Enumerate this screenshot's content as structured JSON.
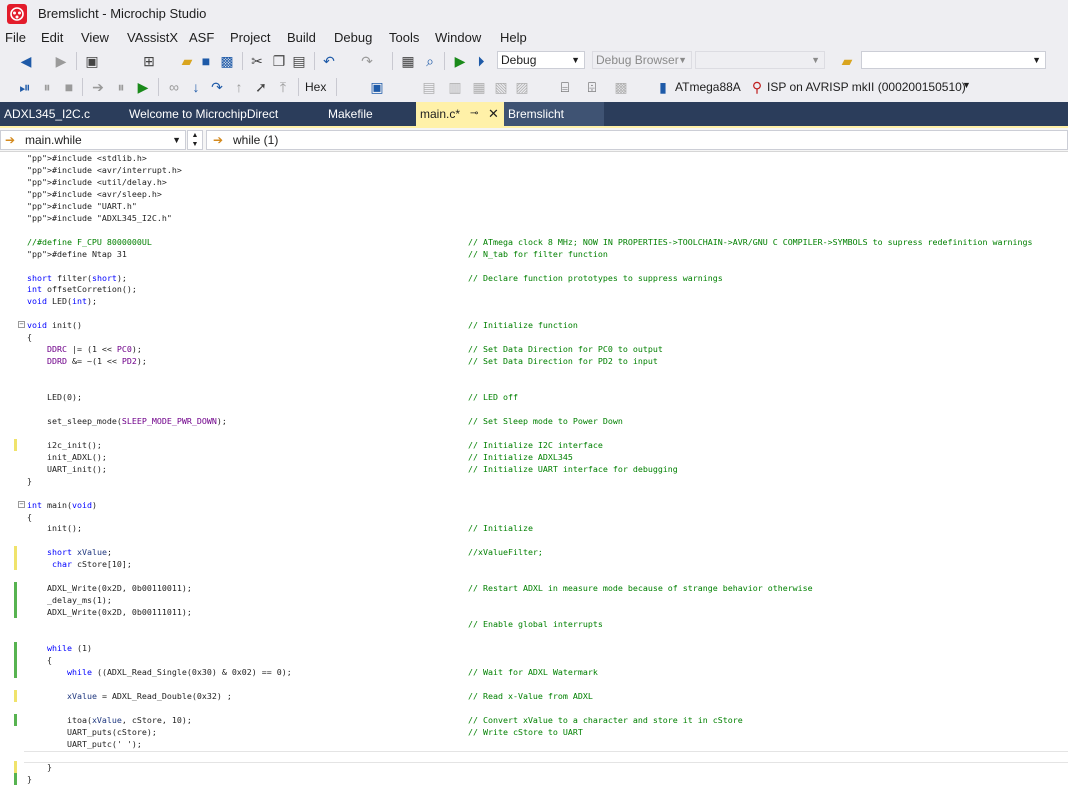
{
  "window": {
    "title": "Bremslicht - Microchip Studio"
  },
  "menu": [
    "File",
    "Edit",
    "View",
    "VAssistX",
    "ASF",
    "Project",
    "Build",
    "Debug",
    "Tools",
    "Window",
    "Help"
  ],
  "toolbar1": {
    "config": "Debug",
    "debug_browser": "Debug Browser",
    "platform": "",
    "find": ""
  },
  "toolbar2": {
    "hex_label": "Hex",
    "device": "ATmega88A",
    "tool": "ISP on AVRISP mkII (000200150510)"
  },
  "tabs": [
    "ADXL345_I2C.c",
    "Welcome to MicrochipDirect",
    "Makefile",
    "main.c*",
    "Bremslicht"
  ],
  "nav": {
    "scope": "main.while",
    "member": "while (1)"
  },
  "code": [
    {
      "t": "#include <stdlib.h>",
      "c": ""
    },
    {
      "t": "#include <avr/interrupt.h>",
      "c": ""
    },
    {
      "t": "#include <util/delay.h>",
      "c": ""
    },
    {
      "t": "#include <avr/sleep.h>",
      "c": ""
    },
    {
      "t": "#include \"UART.h\"",
      "c": ""
    },
    {
      "t": "#include \"ADXL345_I2C.h\"",
      "c": ""
    },
    {
      "t": "",
      "c": ""
    },
    {
      "t": "//#define F_CPU 8000000UL",
      "c": "// ATmega clock 8 MHz; NOW IN PROPERTIES->TOOLCHAIN->AVR/GNU C COMPILER->SYMBOLS to supress redefinition warnings"
    },
    {
      "t": "#define Ntap 31",
      "c": "// N_tab for filter function"
    },
    {
      "t": "",
      "c": ""
    },
    {
      "t": "short filter(short);",
      "c": "// Declare function prototypes to suppress warnings"
    },
    {
      "t": "int offsetCorretion();",
      "c": ""
    },
    {
      "t": "void LED(int);",
      "c": ""
    },
    {
      "t": "",
      "c": ""
    },
    {
      "t": "void init()",
      "c": "// Initialize function"
    },
    {
      "t": "{",
      "c": ""
    },
    {
      "t": "    DDRC |= (1 << PC0);",
      "c": "// Set Data Direction for PC0 to output"
    },
    {
      "t": "    DDRD &= ~(1 << PD2);",
      "c": "// Set Data Direction for PD2 to input"
    },
    {
      "t": "",
      "c": ""
    },
    {
      "t": "",
      "c": ""
    },
    {
      "t": "    LED(0);",
      "c": "// LED off"
    },
    {
      "t": "",
      "c": ""
    },
    {
      "t": "    set_sleep_mode(SLEEP_MODE_PWR_DOWN);",
      "c": "// Set Sleep mode to Power Down"
    },
    {
      "t": "",
      "c": ""
    },
    {
      "t": "    i2c_init();",
      "c": "// Initialize I2C interface"
    },
    {
      "t": "    init_ADXL();",
      "c": "// Initialize ADXL345"
    },
    {
      "t": "    UART_init();",
      "c": "// Initialize UART interface for debugging"
    },
    {
      "t": "}",
      "c": ""
    },
    {
      "t": "",
      "c": ""
    },
    {
      "t": "int main(void)",
      "c": ""
    },
    {
      "t": "{",
      "c": ""
    },
    {
      "t": "    init();",
      "c": "// Initialize"
    },
    {
      "t": "",
      "c": ""
    },
    {
      "t": "    short xValue;",
      "c": "//xValueFilter;"
    },
    {
      "t": "     char cStore[10];",
      "c": ""
    },
    {
      "t": "",
      "c": ""
    },
    {
      "t": "    ADXL_Write(0x2D, 0b00110011);",
      "c": "// Restart ADXL in measure mode because of strange behavior otherwise"
    },
    {
      "t": "    _delay_ms(1);",
      "c": ""
    },
    {
      "t": "    ADXL_Write(0x2D, 0b00111011);",
      "c": ""
    },
    {
      "t": "",
      "c": "// Enable global interrupts"
    },
    {
      "t": "",
      "c": ""
    },
    {
      "t": "    while (1)",
      "c": ""
    },
    {
      "t": "    {",
      "c": ""
    },
    {
      "t": "        while ((ADXL_Read_Single(0x30) & 0x02) == 0);",
      "c": "// Wait for ADXL Watermark"
    },
    {
      "t": "",
      "c": ""
    },
    {
      "t": "        xValue = ADXL_Read_Double(0x32) ;",
      "c": "// Read x-Value from ADXL"
    },
    {
      "t": "",
      "c": ""
    },
    {
      "t": "        itoa(xValue, cStore, 10);",
      "c": "// Convert xValue to a character and store it in cStore"
    },
    {
      "t": "        UART_puts(cStore);",
      "c": "// Write cStore to UART"
    },
    {
      "t": "        UART_putc(' ');",
      "c": ""
    },
    {
      "t": "",
      "c": ""
    },
    {
      "t": "    }",
      "c": ""
    },
    {
      "t": "}",
      "c": ""
    }
  ],
  "colors": {
    "tab_bar": "#2b3d5b",
    "active_tab": "#fff1a8",
    "comment": "#008000",
    "keyword": "#0000ff"
  }
}
